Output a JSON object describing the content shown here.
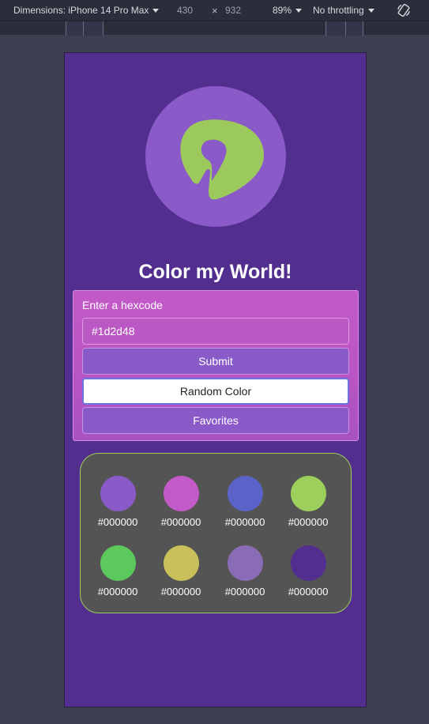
{
  "devtools": {
    "dimensions_label": "Dimensions: iPhone 14 Pro Max",
    "width": "430",
    "times": "×",
    "height": "932",
    "zoom": "89%",
    "throttle": "No throttling"
  },
  "app": {
    "title": "Color my World!",
    "form": {
      "label": "Enter a hexcode",
      "input_value": "#1d2d48",
      "submit_label": "Submit",
      "random_label": "Random Color",
      "favorites_label": "Favorites"
    },
    "swatches": [
      {
        "color": "#8a5ac9",
        "label": "#000000"
      },
      {
        "color": "#c25bc7",
        "label": "#000000"
      },
      {
        "color": "#5b63c9",
        "label": "#000000"
      },
      {
        "color": "#9ccf5b",
        "label": "#000000"
      },
      {
        "color": "#5bc95b",
        "label": "#000000"
      },
      {
        "color": "#c9c05b",
        "label": "#000000"
      },
      {
        "color": "#8a6bb5",
        "label": "#000000"
      },
      {
        "color": "#522e8e",
        "label": "#000000"
      }
    ]
  },
  "colors": {
    "viewport_bg": "#522e8e",
    "logo_circle": "#8a5ac9",
    "logo_mark": "#9cc95b",
    "card_bg": "#c25bc7",
    "panel_bg": "#545454",
    "panel_border": "#9ccf5b"
  }
}
